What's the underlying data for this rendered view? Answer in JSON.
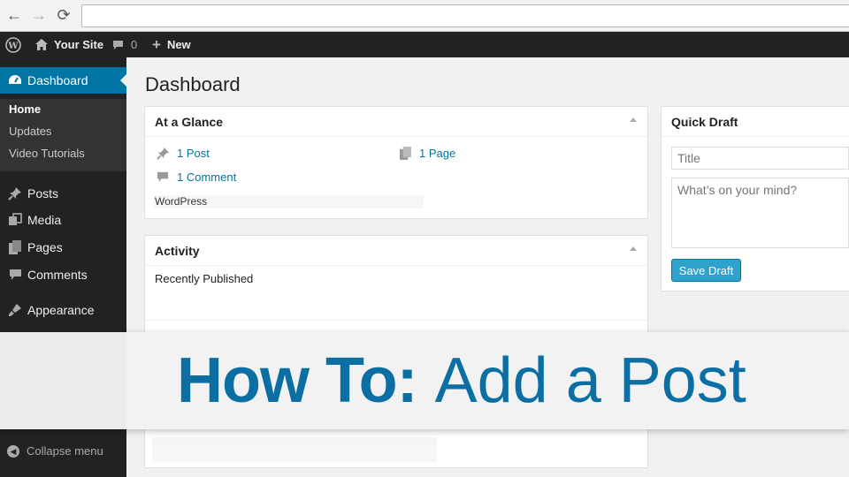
{
  "browser": {
    "back_glyph": "←",
    "forward_glyph": "→",
    "reload_glyph": "⟳",
    "url": ""
  },
  "admin_bar": {
    "site_name": "Your Site",
    "comment_count": "0",
    "new_label": "New"
  },
  "sidebar": {
    "active_item": "Dashboard",
    "submenu": [
      "Home",
      "Updates",
      "Video Tutorials"
    ],
    "items": [
      {
        "label": "Posts",
        "icon": "pin-icon"
      },
      {
        "label": "Media",
        "icon": "media-icon"
      },
      {
        "label": "Pages",
        "icon": "pages-icon"
      },
      {
        "label": "Comments",
        "icon": "comment-icon"
      },
      {
        "label": "Appearance",
        "icon": "brush-icon"
      }
    ],
    "collapse_label": "Collapse menu"
  },
  "main": {
    "title": "Dashboard",
    "at_a_glance": {
      "heading": "At a Glance",
      "posts": "1 Post",
      "pages": "1 Page",
      "comments": "1 Comment",
      "version_text": "WordPress"
    },
    "activity": {
      "heading": "Activity",
      "recently_published": "Recently Published"
    },
    "quick_draft": {
      "heading": "Quick Draft",
      "title_placeholder": "Title",
      "content_placeholder": "What’s on your mind?",
      "save_label": "Save Draft"
    }
  },
  "banner": {
    "bold": "How To:",
    "light": "Add a Post"
  },
  "colors": {
    "accent": "#0074a2",
    "button": "#2ea2cc",
    "banner_text": "#0b6fa4",
    "admin_bg": "#222222"
  }
}
